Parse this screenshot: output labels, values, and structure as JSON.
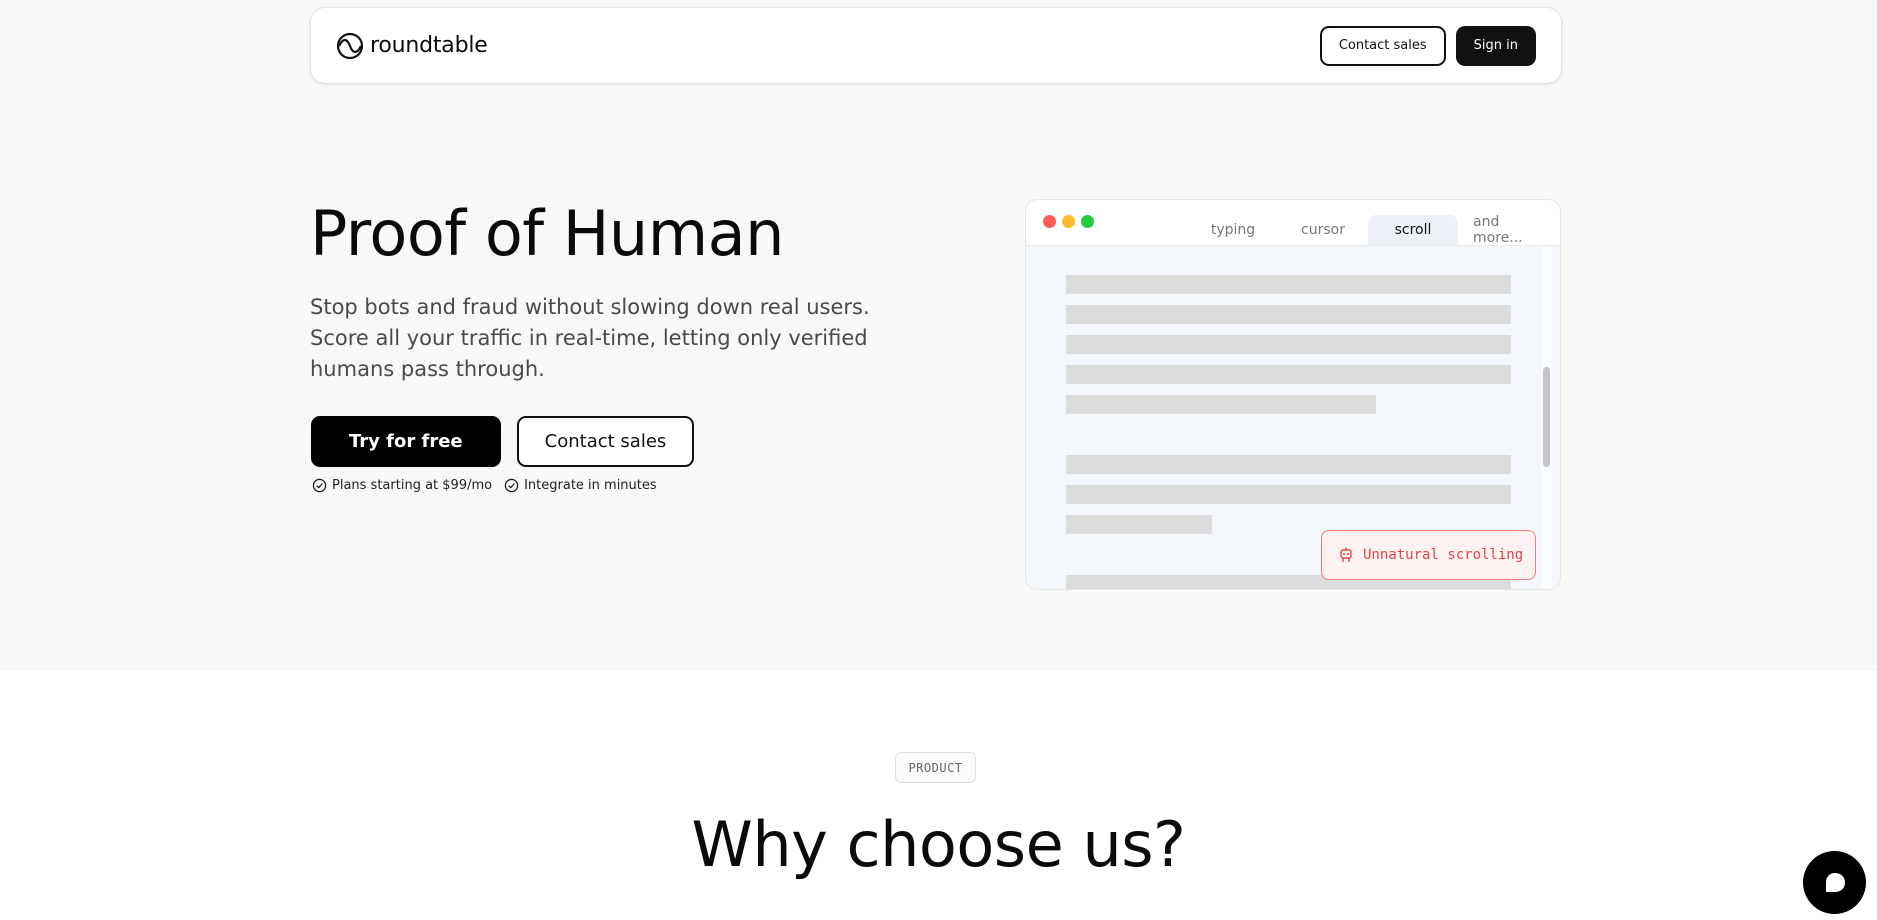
{
  "nav": {
    "brand": "roundtable",
    "contact_label": "Contact sales",
    "signin_label": "Sign in"
  },
  "hero": {
    "title": "Proof of Human",
    "subtitle": "Stop bots and fraud without slowing down real users. Score all your traffic in real-time, letting only verified humans pass through.",
    "primary_label": "Try for free",
    "secondary_label": "Contact sales",
    "perks": [
      "Plans starting at $99/mo",
      "Integrate in minutes"
    ]
  },
  "demo": {
    "tabs": [
      "typing",
      "cursor",
      "scroll",
      "and more..."
    ],
    "active_tab": "scroll",
    "alert": "Unnatural scrolling",
    "alert_icon": "robot-icon"
  },
  "section": {
    "badge": "PRODUCT",
    "title": "Why choose us?"
  },
  "colors": {
    "accent": "#000000",
    "alert": "#e04848",
    "dot_red": "#ff5f57",
    "dot_yellow": "#febc2e",
    "dot_green": "#28c840"
  }
}
